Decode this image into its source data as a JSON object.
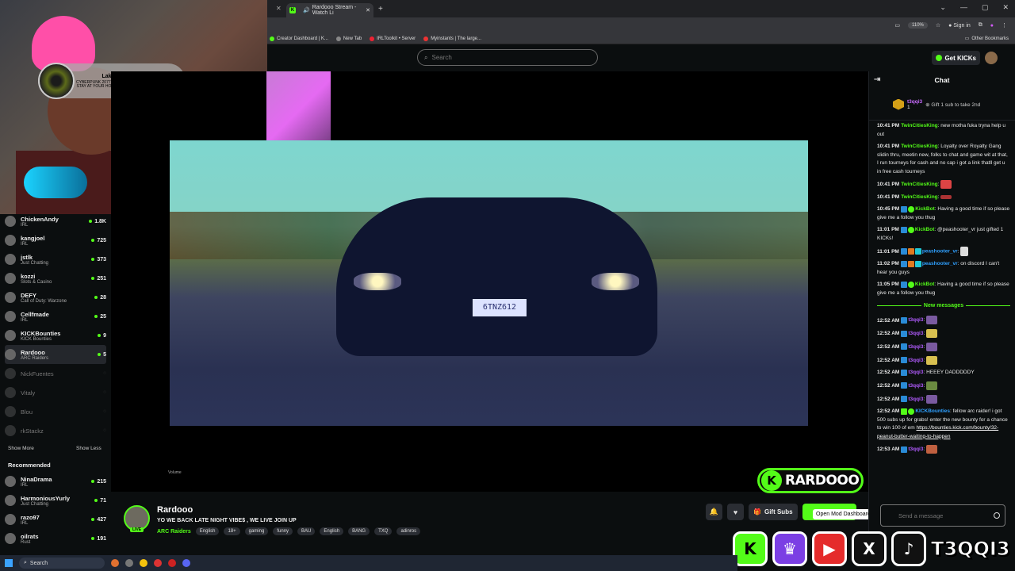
{
  "browser": {
    "tab_title": "Rardooo Stream - Watch Li",
    "new_tab": "+",
    "zoom": "110%",
    "sign_in": "Sign in",
    "bookmarks": [
      "Creator Dashboard | K...",
      "New Tab",
      "IRLToolkit • Server",
      "Myinstants | The large..."
    ],
    "other_bookmarks": "Other Bookmarks"
  },
  "header": {
    "search_placeholder": "Search",
    "get_kicks": "Get KICKs"
  },
  "music_widget": {
    "label": "Lakeshore Records",
    "track": "CYBERPUNK 2077 SOUNDTRACK - I REALLY WANT TO STAY AT YOUR HOUSE by Rosa Walton & Hallie Coggins"
  },
  "sidebar": {
    "following": [
      {
        "name": "ChickenAndy",
        "category": "IRL",
        "viewers": "1.8K"
      },
      {
        "name": "kangjoel",
        "category": "IRL",
        "viewers": "725"
      },
      {
        "name": "jstlk",
        "category": "Just Chatting",
        "viewers": "373"
      },
      {
        "name": "kozzi",
        "category": "Slots & Casino",
        "viewers": "251"
      },
      {
        "name": "DEFY",
        "category": "Call of Duty: Warzone",
        "viewers": "28"
      },
      {
        "name": "Cellfmade",
        "category": "IRL",
        "viewers": "25"
      },
      {
        "name": "KICKBounties",
        "category": "KICK Bounties",
        "viewers": "9"
      },
      {
        "name": "Rardooo",
        "category": "ARC Raiders",
        "viewers": "5"
      }
    ],
    "offline": [
      "NickFuentes",
      "Vitaly",
      "Blou",
      "rkStackz"
    ],
    "show_more": "Show More",
    "show_less": "Show Less",
    "recommended_title": "Recommended",
    "recommended": [
      {
        "name": "NinaDrama",
        "category": "IRL",
        "viewers": "215"
      },
      {
        "name": "HarmoniousYurly",
        "category": "Just Chatting",
        "viewers": "71"
      },
      {
        "name": "razo97",
        "category": "IRL",
        "viewers": "427"
      },
      {
        "name": "oilrats",
        "category": "Rust",
        "viewers": "191"
      }
    ]
  },
  "video": {
    "plate": "6TNZ612",
    "volume_label": "Volume"
  },
  "stream_info": {
    "streamer": "Rardooo",
    "live": "LIVE",
    "title": "YO WE BACK LATE NIGHT VIBE$ , WE LIVE JOIN UP",
    "category": "ARC Raiders",
    "tags": [
      "English",
      "18+",
      "gaming",
      "funny",
      "BAU",
      "English",
      "BANG",
      "TXQ",
      "adinros"
    ],
    "gift_subs": "Gift Subs",
    "tooltip": "Open Mod Dashboard"
  },
  "chat": {
    "title": "Chat",
    "pinned_user": "t3qqi3",
    "pinned_rank": "1",
    "pinned_text": "Gift 1 sub to take 2nd",
    "messages": [
      {
        "ts": "10:41 PM",
        "user": "TwinCitiesKing",
        "text": "new motha fuka tryna help u out"
      },
      {
        "ts": "10:41 PM",
        "user": "TwinCitiesKing",
        "text": "Loyalty over Royalty Gang slidin thru, meetin new, folks to chat and game wit at that, I run tourneys for cash and no cap i got a link thatll get u in free cash tourneys"
      },
      {
        "ts": "10:41 PM",
        "user": "TwinCitiesKing",
        "text": ""
      },
      {
        "ts": "10:41 PM",
        "user": "TwinCitiesKing",
        "text": ""
      },
      {
        "ts": "10:45 PM",
        "user": "KickBot",
        "text": "Having a good time if so please give me a follow you thug"
      },
      {
        "ts": "11:01 PM",
        "user": "KickBot",
        "text": "@peashooter_vr just gifted 1 KICKs!"
      },
      {
        "ts": "11:01 PM",
        "user": "peashooter_vr",
        "text": ""
      },
      {
        "ts": "11:02 PM",
        "user": "peashooter_vr",
        "text": "on discord I can't hear you guys"
      },
      {
        "ts": "11:05 PM",
        "user": "KickBot",
        "text": "Having a good time if so please give me a follow you thug"
      }
    ],
    "new_messages": "New messages",
    "new": [
      {
        "ts": "12:52 AM",
        "user": "t3qqi3",
        "text": ""
      },
      {
        "ts": "12:52 AM",
        "user": "t3qqi3",
        "text": ""
      },
      {
        "ts": "12:52 AM",
        "user": "t3qqi3",
        "text": ""
      },
      {
        "ts": "12:52 AM",
        "user": "t3qqi3",
        "text": ""
      },
      {
        "ts": "12:52 AM",
        "user": "t3qqi3",
        "text": "HEEEY DADDDDDY"
      },
      {
        "ts": "12:52 AM",
        "user": "t3qqi3",
        "text": ""
      },
      {
        "ts": "12:52 AM",
        "user": "t3qqi3",
        "text": ""
      }
    ],
    "bounty_ts": "12:52 AM",
    "bounty_user": "KICKBounties",
    "bounty_text": "fellow arc raider! i got 500 subs up for grabs! enter the new bounty for a chance to win 100 of em",
    "bounty_link": "https://bounties.kick.com/bounty/32-peanut-butter-waiting-to-happen",
    "last_ts": "12:53 AM",
    "last_user": "t3qqi3",
    "input_placeholder": "Send a message"
  },
  "overlay": {
    "brand": "RARDOOO",
    "brand_letter": "K",
    "handle": "T3QQI3",
    "socials": [
      "K",
      "♛",
      "▶",
      "X",
      "♪"
    ]
  },
  "taskbar": {
    "search": "Search"
  }
}
